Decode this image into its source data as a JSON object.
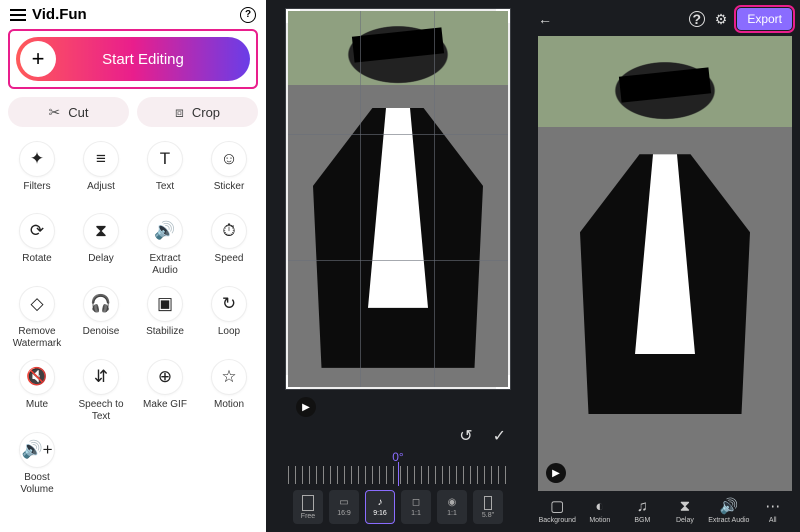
{
  "left": {
    "brand": "Vid.Fun",
    "start_label": "Start Editing",
    "cut_label": "Cut",
    "crop_label": "Crop",
    "tools": [
      {
        "icon": "✦",
        "label": "Filters",
        "name": "filters"
      },
      {
        "icon": "≡",
        "label": "Adjust",
        "name": "adjust"
      },
      {
        "icon": "T",
        "label": "Text",
        "name": "text"
      },
      {
        "icon": "☺",
        "label": "Sticker",
        "name": "sticker"
      },
      {
        "icon": "⟳",
        "label": "Rotate",
        "name": "rotate"
      },
      {
        "icon": "⧗",
        "label": "Delay",
        "name": "delay"
      },
      {
        "icon": "🔊",
        "label": "Extract Audio",
        "name": "extract-audio"
      },
      {
        "icon": "⏱",
        "label": "Speed",
        "name": "speed"
      },
      {
        "icon": "◇",
        "label": "Remove Watermark",
        "name": "remove-watermark"
      },
      {
        "icon": "🎧",
        "label": "Denoise",
        "name": "denoise"
      },
      {
        "icon": "▣",
        "label": "Stabilize",
        "name": "stabilize"
      },
      {
        "icon": "↻",
        "label": "Loop",
        "name": "loop"
      },
      {
        "icon": "🔇",
        "label": "Mute",
        "name": "mute"
      },
      {
        "icon": "⇵",
        "label": "Speech to Text",
        "name": "speech-to-text"
      },
      {
        "icon": "⊕",
        "label": "Make GIF",
        "name": "make-gif"
      },
      {
        "icon": "☆",
        "label": "Motion",
        "name": "motion"
      },
      {
        "icon": "🔊+",
        "label": "Boost Volume",
        "name": "boost-volume"
      }
    ]
  },
  "mid": {
    "angle": "0°",
    "ratios": [
      {
        "label": "Free",
        "w": 12,
        "h": 16,
        "ico": ""
      },
      {
        "label": "16:9",
        "w": 18,
        "h": 10,
        "ico": "▭"
      },
      {
        "label": "9:16",
        "w": 8,
        "h": 14,
        "ico": "♪",
        "selected": true
      },
      {
        "label": "1:1",
        "w": 12,
        "h": 12,
        "ico": "◻"
      },
      {
        "label": "1:1",
        "w": 12,
        "h": 12,
        "ico": "◉"
      },
      {
        "label": "5.8\"",
        "w": 8,
        "h": 14,
        "ico": ""
      }
    ]
  },
  "right": {
    "export_label": "Export",
    "toolbar": [
      {
        "icon": "▢",
        "label": "Background",
        "name": "background"
      },
      {
        "icon": "◐",
        "label": "Motion",
        "name": "motion"
      },
      {
        "icon": "♫",
        "label": "BGM",
        "name": "bgm"
      },
      {
        "icon": "⧗",
        "label": "Delay",
        "name": "delay"
      },
      {
        "icon": "🔊",
        "label": "Extract Audio",
        "name": "extract-audio"
      },
      {
        "icon": "⋯",
        "label": "All",
        "name": "all"
      }
    ]
  }
}
